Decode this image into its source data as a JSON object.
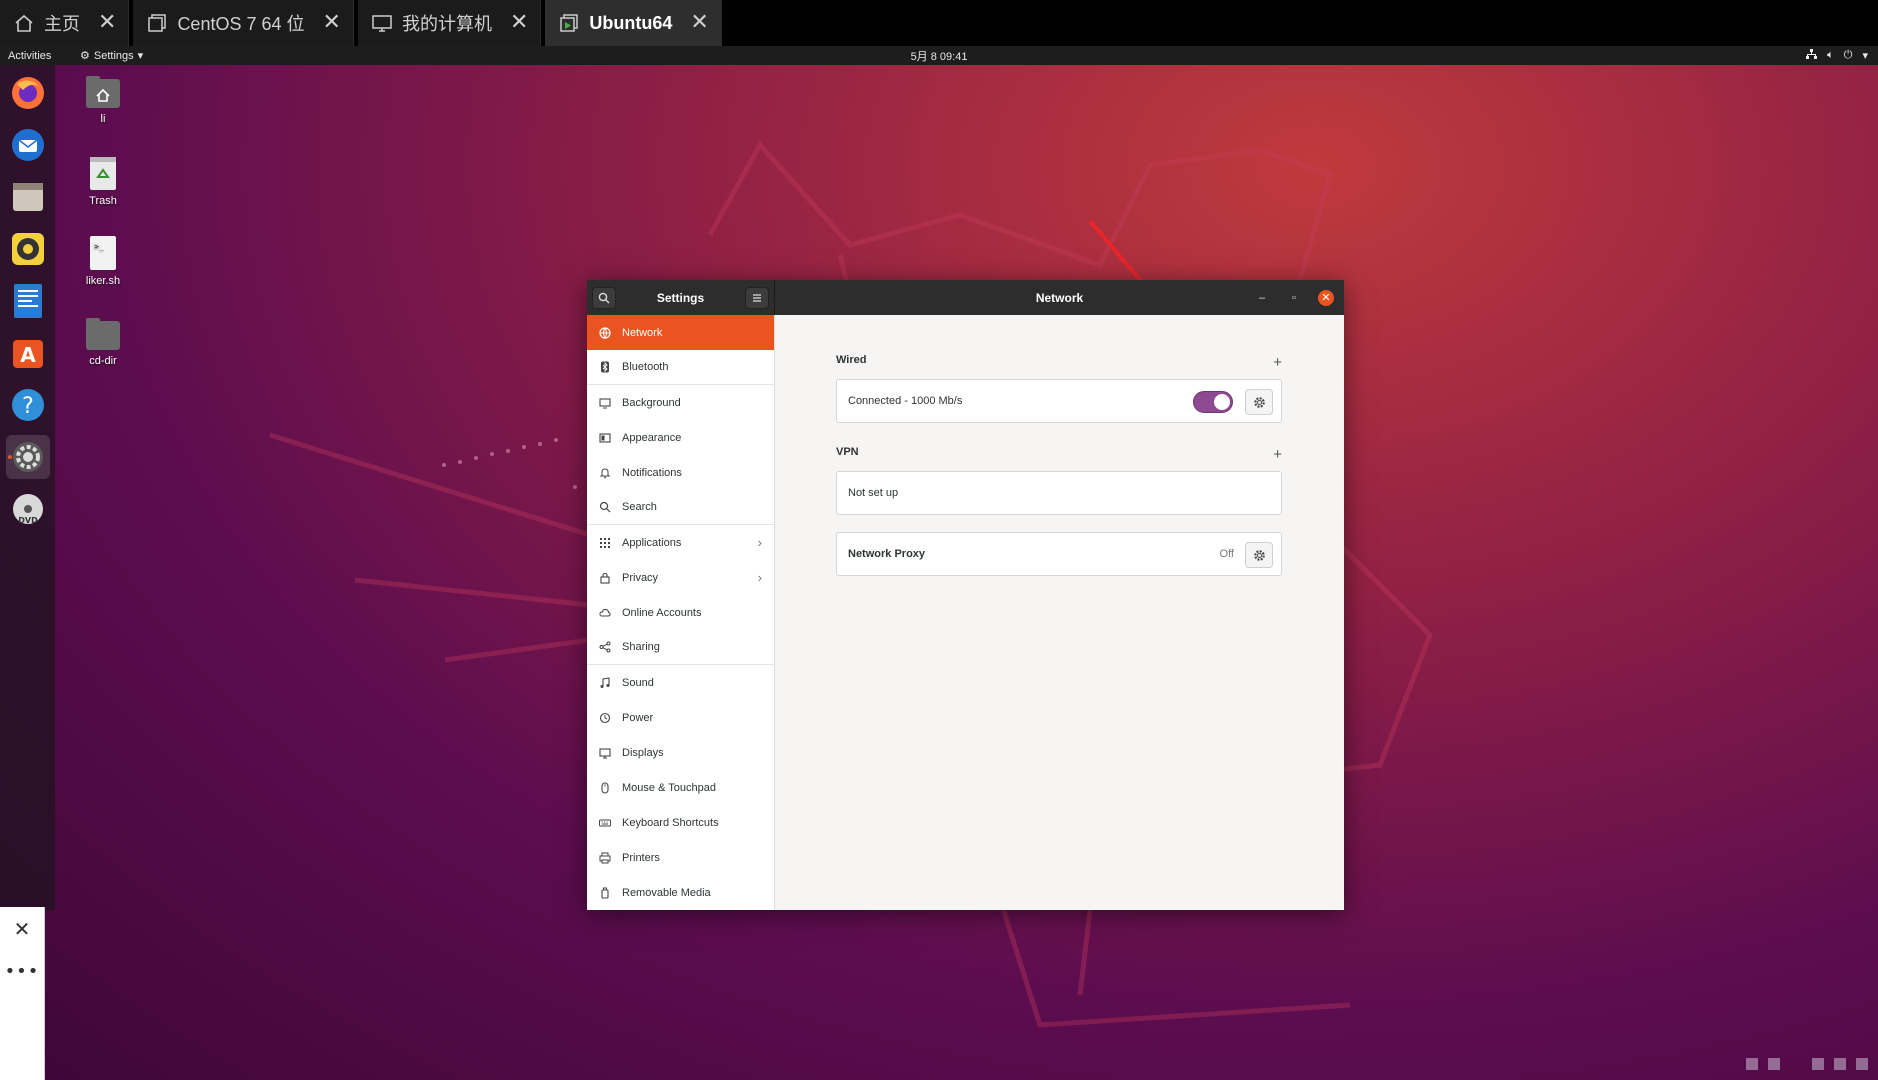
{
  "vm_tabs": [
    {
      "label": "主页",
      "icon": "home-icon"
    },
    {
      "label": "CentOS 7 64 位",
      "icon": "vm-icon"
    },
    {
      "label": "我的计算机",
      "icon": "monitor-icon"
    },
    {
      "label": "Ubuntu64",
      "icon": "vm-running-icon",
      "active": true
    }
  ],
  "top_bar": {
    "activities": "Activities",
    "app_menu": "Settings",
    "clock": "5月 8  09:41"
  },
  "desktop_icons": [
    {
      "label": "li",
      "icon": "home-folder-icon"
    },
    {
      "label": "Trash",
      "icon": "trash-icon"
    },
    {
      "label": "liker.sh",
      "icon": "script-file-icon"
    },
    {
      "label": "cd-dir",
      "icon": "folder-icon"
    }
  ],
  "dock": [
    "firefox-icon",
    "thunderbird-icon",
    "files-icon",
    "rhythmbox-icon",
    "writer-icon",
    "software-icon",
    "help-icon",
    "settings-icon",
    "dvd-icon"
  ],
  "settings": {
    "sidebar_title": "Settings",
    "page_title": "Network",
    "sidebar_items": [
      {
        "label": "Network",
        "icon": "network-icon",
        "selected": true
      },
      {
        "label": "Bluetooth",
        "icon": "bluetooth-icon"
      },
      {
        "label": "Background",
        "icon": "background-icon"
      },
      {
        "label": "Appearance",
        "icon": "appearance-icon"
      },
      {
        "label": "Notifications",
        "icon": "notifications-icon"
      },
      {
        "label": "Search",
        "icon": "search-icon"
      },
      {
        "label": "Applications",
        "icon": "applications-icon",
        "chevron": true
      },
      {
        "label": "Privacy",
        "icon": "privacy-icon",
        "chevron": true
      },
      {
        "label": "Online Accounts",
        "icon": "cloud-icon"
      },
      {
        "label": "Sharing",
        "icon": "sharing-icon"
      },
      {
        "label": "Sound",
        "icon": "music-icon"
      },
      {
        "label": "Power",
        "icon": "power-icon"
      },
      {
        "label": "Displays",
        "icon": "display-icon"
      },
      {
        "label": "Mouse & Touchpad",
        "icon": "mouse-icon"
      },
      {
        "label": "Keyboard Shortcuts",
        "icon": "keyboard-icon"
      },
      {
        "label": "Printers",
        "icon": "printer-icon"
      },
      {
        "label": "Removable Media",
        "icon": "removable-media-icon"
      }
    ],
    "wired": {
      "title": "Wired",
      "add": "+",
      "status": "Connected - 1000 Mb/s",
      "enabled": true
    },
    "vpn": {
      "title": "VPN",
      "add": "+",
      "status": "Not set up"
    },
    "proxy": {
      "label": "Network Proxy",
      "state": "Off"
    }
  },
  "colors": {
    "accent": "#e95420",
    "toggle_on": "#8e4a91",
    "arrow": "#e8262a"
  }
}
